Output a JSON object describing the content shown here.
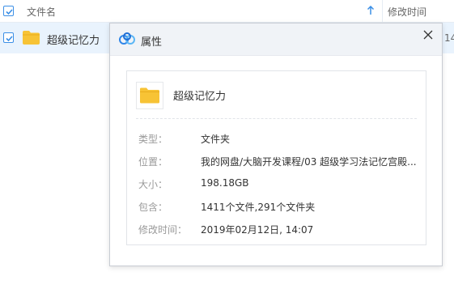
{
  "file_list": {
    "header": {
      "name_col": "文件名",
      "mtime_col": "修改时间",
      "sort_icon": "arrow-up-icon"
    },
    "rows": [
      {
        "name": "超级记忆力",
        "date_partial": "14",
        "selected": true,
        "icon": "folder-icon"
      }
    ]
  },
  "dialog": {
    "title": "属性",
    "logo_icon": "baidu-netdisk-logo",
    "close_icon": "close-icon",
    "item_name": "超级记忆力",
    "properties": [
      {
        "label": "类型：",
        "value": "文件夹"
      },
      {
        "label": "位置：",
        "value": "我的网盘/大脑开发课程/03 超级学习法记忆宫殿..."
      },
      {
        "label": "大小：",
        "value": "198.18GB"
      },
      {
        "label": "包含：",
        "value": "1411个文件,291个文件夹"
      },
      {
        "label": "修改时间：",
        "value": "2019年02月12日, 14:07"
      }
    ]
  },
  "colors": {
    "accent": "#3b8fe6",
    "selected_row": "#e9f3fd",
    "folder": "#f7c335",
    "dialog_header": "#f0f3f7",
    "label_gray": "#999999"
  }
}
